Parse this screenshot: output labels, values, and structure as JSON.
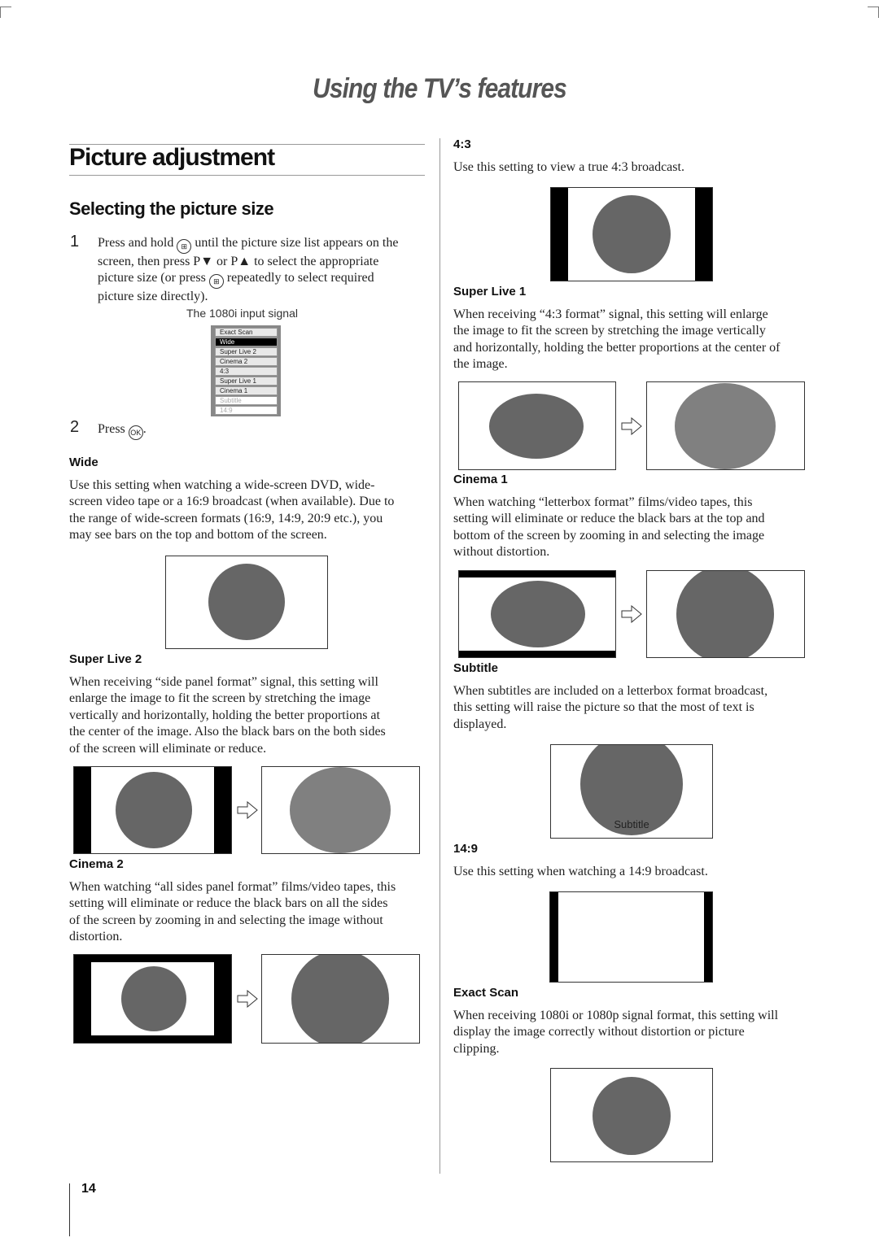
{
  "header": {
    "title": "Using the TV’s features"
  },
  "section": {
    "title": "Picture adjustment",
    "subtitle": "Selecting the picture size"
  },
  "steps": [
    {
      "num": "1",
      "lines": [
        "Press and hold",
        "until the picture size list appears on the",
        "screen, then press P▼ or P▲ to select the appropriate",
        "picture size (or press",
        "repeatedly to select required",
        "picture size directly)."
      ]
    },
    {
      "num": "2",
      "text": "Press",
      "end": "."
    }
  ],
  "buttons": {
    "picture_size": "⊞",
    "ok": "OK"
  },
  "menu": {
    "caption": "The 1080i input signal",
    "items": [
      "Exact Scan",
      "Wide",
      "Super Live 2",
      "Cinema 2",
      "4:3",
      "Super Live 1",
      "Cinema 1",
      "Subtitle",
      "14:9"
    ],
    "selected": "Wide",
    "disabled": [
      "Subtitle",
      "14:9"
    ]
  },
  "modes": {
    "wide": {
      "title": "Wide",
      "lines": [
        "Use this setting when watching a wide-screen DVD, wide-",
        "screen video tape or a 16:9 broadcast (when available). Due to",
        "the range of wide-screen formats (16:9, 14:9, 20:9 etc.), you",
        "may see bars on the top and bottom of the screen."
      ]
    },
    "superlive2": {
      "title": "Super Live 2",
      "lines": [
        "When receiving “side panel format” signal, this setting will",
        "enlarge the image to fit the screen by stretching the image",
        "vertically and horizontally, holding the better proportions at",
        "the center of the image. Also the black bars on the both sides",
        "of the screen will eliminate or reduce."
      ]
    },
    "cinema2": {
      "title": "Cinema 2",
      "lines": [
        "When watching “all sides panel format” films/video tapes, this",
        "setting will eliminate or reduce the black bars on all the sides",
        "of the screen by zooming in and selecting the image without",
        "distortion."
      ]
    },
    "r43": {
      "title": "4:3",
      "lines": [
        "Use this setting to view a true 4:3 broadcast."
      ]
    },
    "superlive1": {
      "title": "Super Live 1",
      "lines": [
        "When receiving “4:3 format” signal, this setting will enlarge",
        "the image to fit the screen by stretching the image vertically",
        "and horizontally, holding the better proportions at the center of",
        "the image."
      ]
    },
    "cinema1": {
      "title": "Cinema 1",
      "lines": [
        "When watching “letterbox format” films/video tapes, this",
        "setting will eliminate or reduce the black bars at the top and",
        "bottom of the screen by zooming in and selecting the image",
        "without distortion."
      ]
    },
    "subtitle": {
      "title": "Subtitle",
      "lines": [
        "When subtitles are included on a letterbox format broadcast,",
        "this setting will raise the picture so that the most of text is",
        "displayed."
      ],
      "diagram_label": "Subtitle"
    },
    "r149": {
      "title": "14:9",
      "lines": [
        "Use this setting when watching a 14:9 broadcast."
      ]
    },
    "exactscan": {
      "title": "Exact Scan",
      "lines": [
        "When receiving 1080i or 1080p signal format, this setting will",
        "display the image correctly without distortion or picture",
        "clipping."
      ]
    }
  },
  "colors": {
    "image_dark": "#666666",
    "image_light": "#808080",
    "bars": "#000000"
  },
  "footer": {
    "page_number": "14"
  }
}
